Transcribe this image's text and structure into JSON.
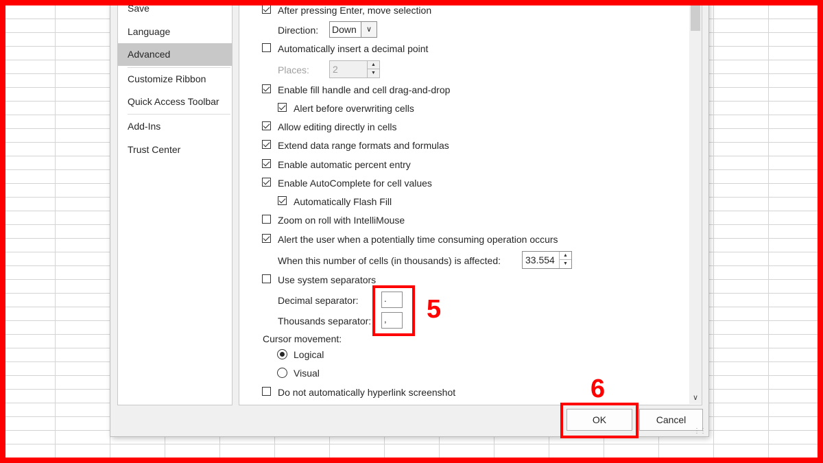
{
  "nav": {
    "items": [
      {
        "label": "Save",
        "selected": false
      },
      {
        "label": "Language",
        "selected": false
      },
      {
        "label": "Advanced",
        "selected": true
      },
      {
        "label": "Customize Ribbon",
        "selected": false
      },
      {
        "label": "Quick Access Toolbar",
        "selected": false
      },
      {
        "label": "Add-Ins",
        "selected": false
      },
      {
        "label": "Trust Center",
        "selected": false
      }
    ]
  },
  "options": {
    "move_selection": {
      "label": "After pressing Enter, move selection",
      "checked": true
    },
    "direction": {
      "label": "Direction:",
      "value": "Down"
    },
    "decimal_point": {
      "label": "Automatically insert a decimal point",
      "checked": false
    },
    "places": {
      "label": "Places:",
      "value": "2"
    },
    "fill_handle": {
      "label": "Enable fill handle and cell drag-and-drop",
      "checked": true
    },
    "alert_overwrite": {
      "label": "Alert before overwriting cells",
      "checked": true
    },
    "edit_in_cells": {
      "label": "Allow editing directly in cells",
      "checked": true
    },
    "extend_formats": {
      "label": "Extend data range formats and formulas",
      "checked": true
    },
    "percent_entry": {
      "label": "Enable automatic percent entry",
      "checked": true
    },
    "autocomplete": {
      "label": "Enable AutoComplete for cell values",
      "checked": true
    },
    "flash_fill": {
      "label": "Automatically Flash Fill",
      "checked": true
    },
    "zoom_roll": {
      "label": "Zoom on roll with IntelliMouse",
      "checked": false
    },
    "alert_time": {
      "label": "Alert the user when a potentially time consuming operation occurs",
      "checked": true
    },
    "cells_affected": {
      "label": "When this number of cells (in thousands) is affected:",
      "value": "33.554"
    },
    "system_separators": {
      "label": "Use system separators",
      "checked": false
    },
    "decimal_separator": {
      "label": "Decimal separator:",
      "value": "."
    },
    "thousands_separator": {
      "label": "Thousands separator:",
      "value": ","
    },
    "cursor_movement": {
      "label": "Cursor movement:",
      "logical": {
        "label": "Logical",
        "selected": true
      },
      "visual": {
        "label": "Visual",
        "selected": false
      }
    },
    "no_hyperlink": {
      "label": "Do not automatically hyperlink screenshot",
      "checked": false
    }
  },
  "buttons": {
    "ok": "OK",
    "cancel": "Cancel"
  },
  "annotations": {
    "step5": "5",
    "step6": "6"
  },
  "colors": {
    "highlight": "#ff0000",
    "nav_selected": "#c8c8c8"
  }
}
